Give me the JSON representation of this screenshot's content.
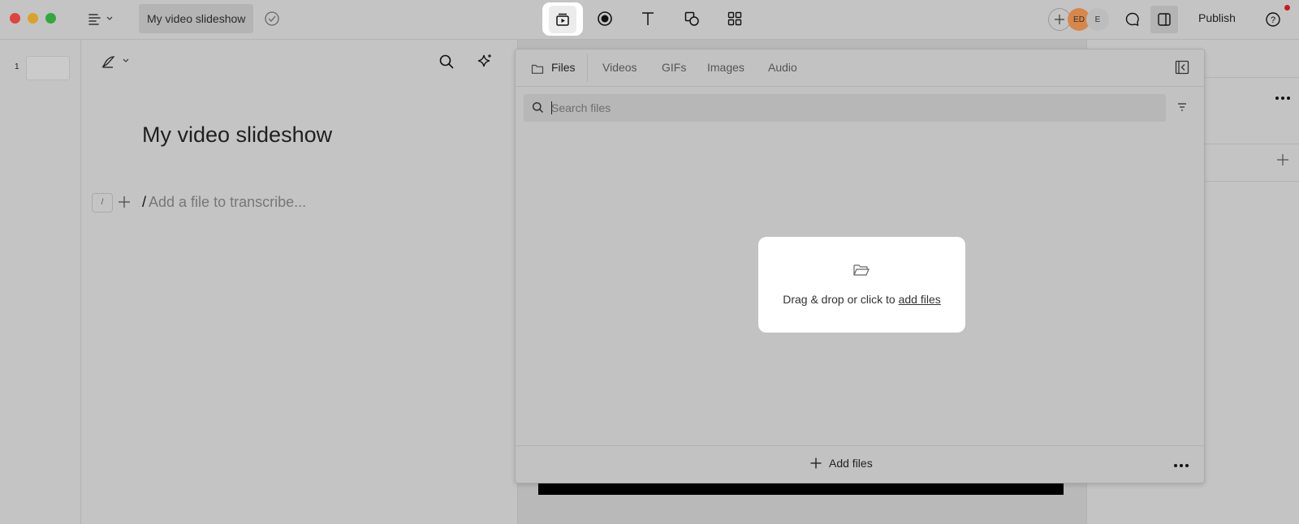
{
  "window": {
    "document_title": "My video slideshow"
  },
  "toolbar": {
    "tools": [
      "media-icon",
      "record-icon",
      "text-icon",
      "shapes-icon",
      "grid-icon"
    ],
    "avatars": [
      "ED",
      "E"
    ],
    "publish_label": "Publish",
    "help_label": "?"
  },
  "slides": {
    "items": [
      {
        "number": "1"
      }
    ]
  },
  "editor": {
    "title": "My video slideshow",
    "slash_key": "/",
    "prompt_slash": "/",
    "prompt": "Add a file to transcribe..."
  },
  "media_panel": {
    "tabs": [
      {
        "label": "Files",
        "active": true
      },
      {
        "label": "Videos",
        "active": false
      },
      {
        "label": "GIFs",
        "active": false
      },
      {
        "label": "Images",
        "active": false
      },
      {
        "label": "Audio",
        "active": false
      }
    ],
    "search": {
      "placeholder": "Search files",
      "value": ""
    },
    "dropzone": {
      "text": "Drag & drop or click to ",
      "link": "add files"
    },
    "footer": {
      "add_label": "Add files"
    }
  },
  "colors": {
    "background": "#c4c4c4",
    "panel": "#c2c2c2",
    "notification": "#d01919"
  }
}
